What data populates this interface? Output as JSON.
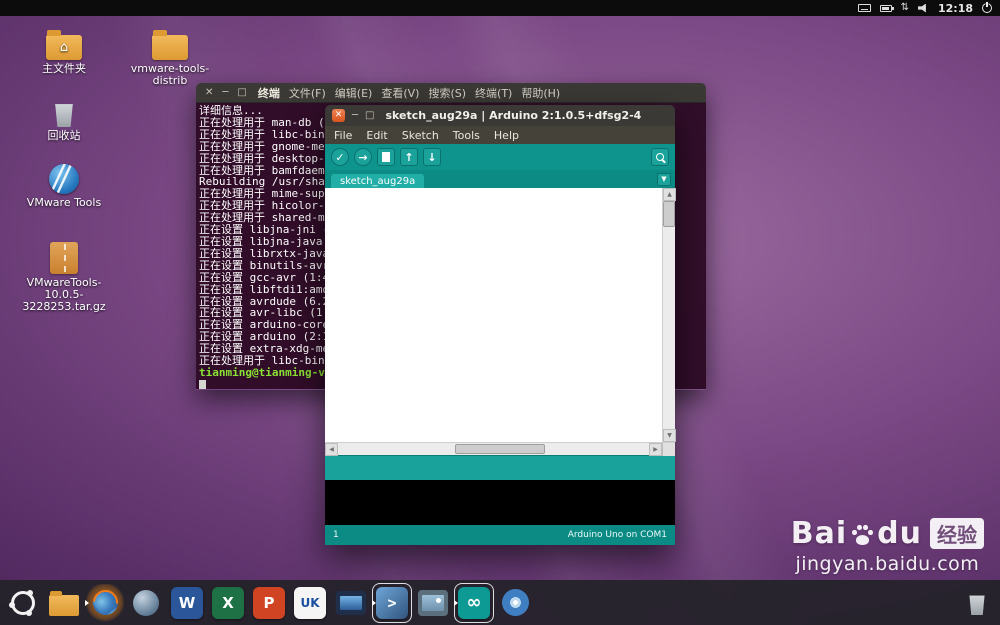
{
  "wm": {
    "close": "✕",
    "min": "─",
    "max": "□"
  },
  "icons": {
    "up": "▲",
    "down": "▼",
    "left": "◀",
    "right": "▶",
    "dropdown": "▼",
    "network": "⇅",
    "home": "⌂"
  },
  "topbar": {
    "time": "12:18"
  },
  "desktop": {
    "icons": [
      {
        "label": "主文件夹"
      },
      {
        "label": "vmware-tools-distrib"
      },
      {
        "label": "回收站"
      },
      {
        "label": "VMware Tools"
      },
      {
        "label": "VMwareTools-10.0.5-3228253.tar.gz"
      }
    ]
  },
  "terminal": {
    "title": "终端",
    "menu": [
      "文件(F)",
      "编辑(E)",
      "查看(V)",
      "搜索(S)",
      "终端(T)",
      "帮助(H)"
    ],
    "lines": [
      "详细信息...",
      "正在处理用于 man-db (2.6.7.1-1ubuntu1) 的触发器 ...",
      "正在处理用于 libc-bin (2.19-0ubuntu6) 的触发器 ...",
      "正在处理用于 gnome-menus (3.10.1-0ubuntu2) 的触发器 ...",
      "正在处理用于 desktop-file-utils (0.22-1ubuntu1) 的触发器 ...",
      "正在处理用于 bamfdaemon (0.5.1+14.04.20140409-0ubuntu1) 的触发器 ...",
      "Rebuilding /usr/share/applications/bamf-2.index...",
      "正在处理用于 mime-support (3.54ubuntu1.1) 的触发器 ...",
      "正在处理用于 hicolor-icon-theme (0.13-1) 的触发器 ...",
      "正在处理用于 shared-mime-info (1.2-0ubuntu3) 的触发器 ...",
      "正在设置 libjna-jni (4.1.0-1) ...",
      "正在设置 libjna-java (4.1.0-1) ...",
      "正在设置 librxtx-java (2.2pre2-13) ...",
      "正在设置 binutils-avr (2.23.1-2.1) ...",
      "正在设置 gcc-avr (1:4.8-2.1) ...",
      "正在设置 libftdi1:amd64 (0.20-2ubuntu2) ...",
      "正在设置 avrdude (6.2-5) ...",
      "正在设置 avr-libc (1:1.8.0-4.1) ...",
      "正在设置 arduino-core (2:1.0.5+dfsg2-4) ...",
      "正在设置 arduino (2:1.0.5+dfsg2-4) ...",
      "正在设置 extra-xdg-menus (1.0-4) ...",
      "正在处理用于 libc-bin (2.19-0ubuntu6) 的触发器 ..."
    ],
    "prompt": "tianming@tianming-virtual-machine:~$"
  },
  "arduino": {
    "title": "sketch_aug29a | Arduino 2:1.0.5+dfsg2-4",
    "menu": [
      "File",
      "Edit",
      "Sketch",
      "Tools",
      "Help"
    ],
    "toolbar": {
      "verify": "✓",
      "upload": "→",
      "open": "↑",
      "save": "↓"
    },
    "tab": "sketch_aug29a",
    "status_left": "1",
    "status_right": "Arduino Uno on COM1",
    "accent": "#0f948d"
  },
  "dock": {
    "items": [
      {
        "name": "ubuntu-dash"
      },
      {
        "name": "files"
      },
      {
        "name": "firefox"
      },
      {
        "name": "sphere-app"
      },
      {
        "name": "word",
        "glyph": "W",
        "color": "#2b579a"
      },
      {
        "name": "excel",
        "glyph": "X",
        "color": "#1e7145"
      },
      {
        "name": "powerpoint",
        "glyph": "P",
        "color": "#d04423"
      },
      {
        "name": "uk-app",
        "glyph": "UK",
        "color": "#f5f5f5"
      },
      {
        "name": "display-app"
      },
      {
        "name": "terminal",
        "glyph": ">"
      },
      {
        "name": "photos"
      },
      {
        "name": "arduino",
        "glyph": "∞",
        "color": "#0e9a94"
      },
      {
        "name": "media-player"
      }
    ]
  },
  "watermark": {
    "brand_a": "Bai",
    "brand_b": "du",
    "badge": "经验",
    "url": "jingyan.baidu.com"
  }
}
